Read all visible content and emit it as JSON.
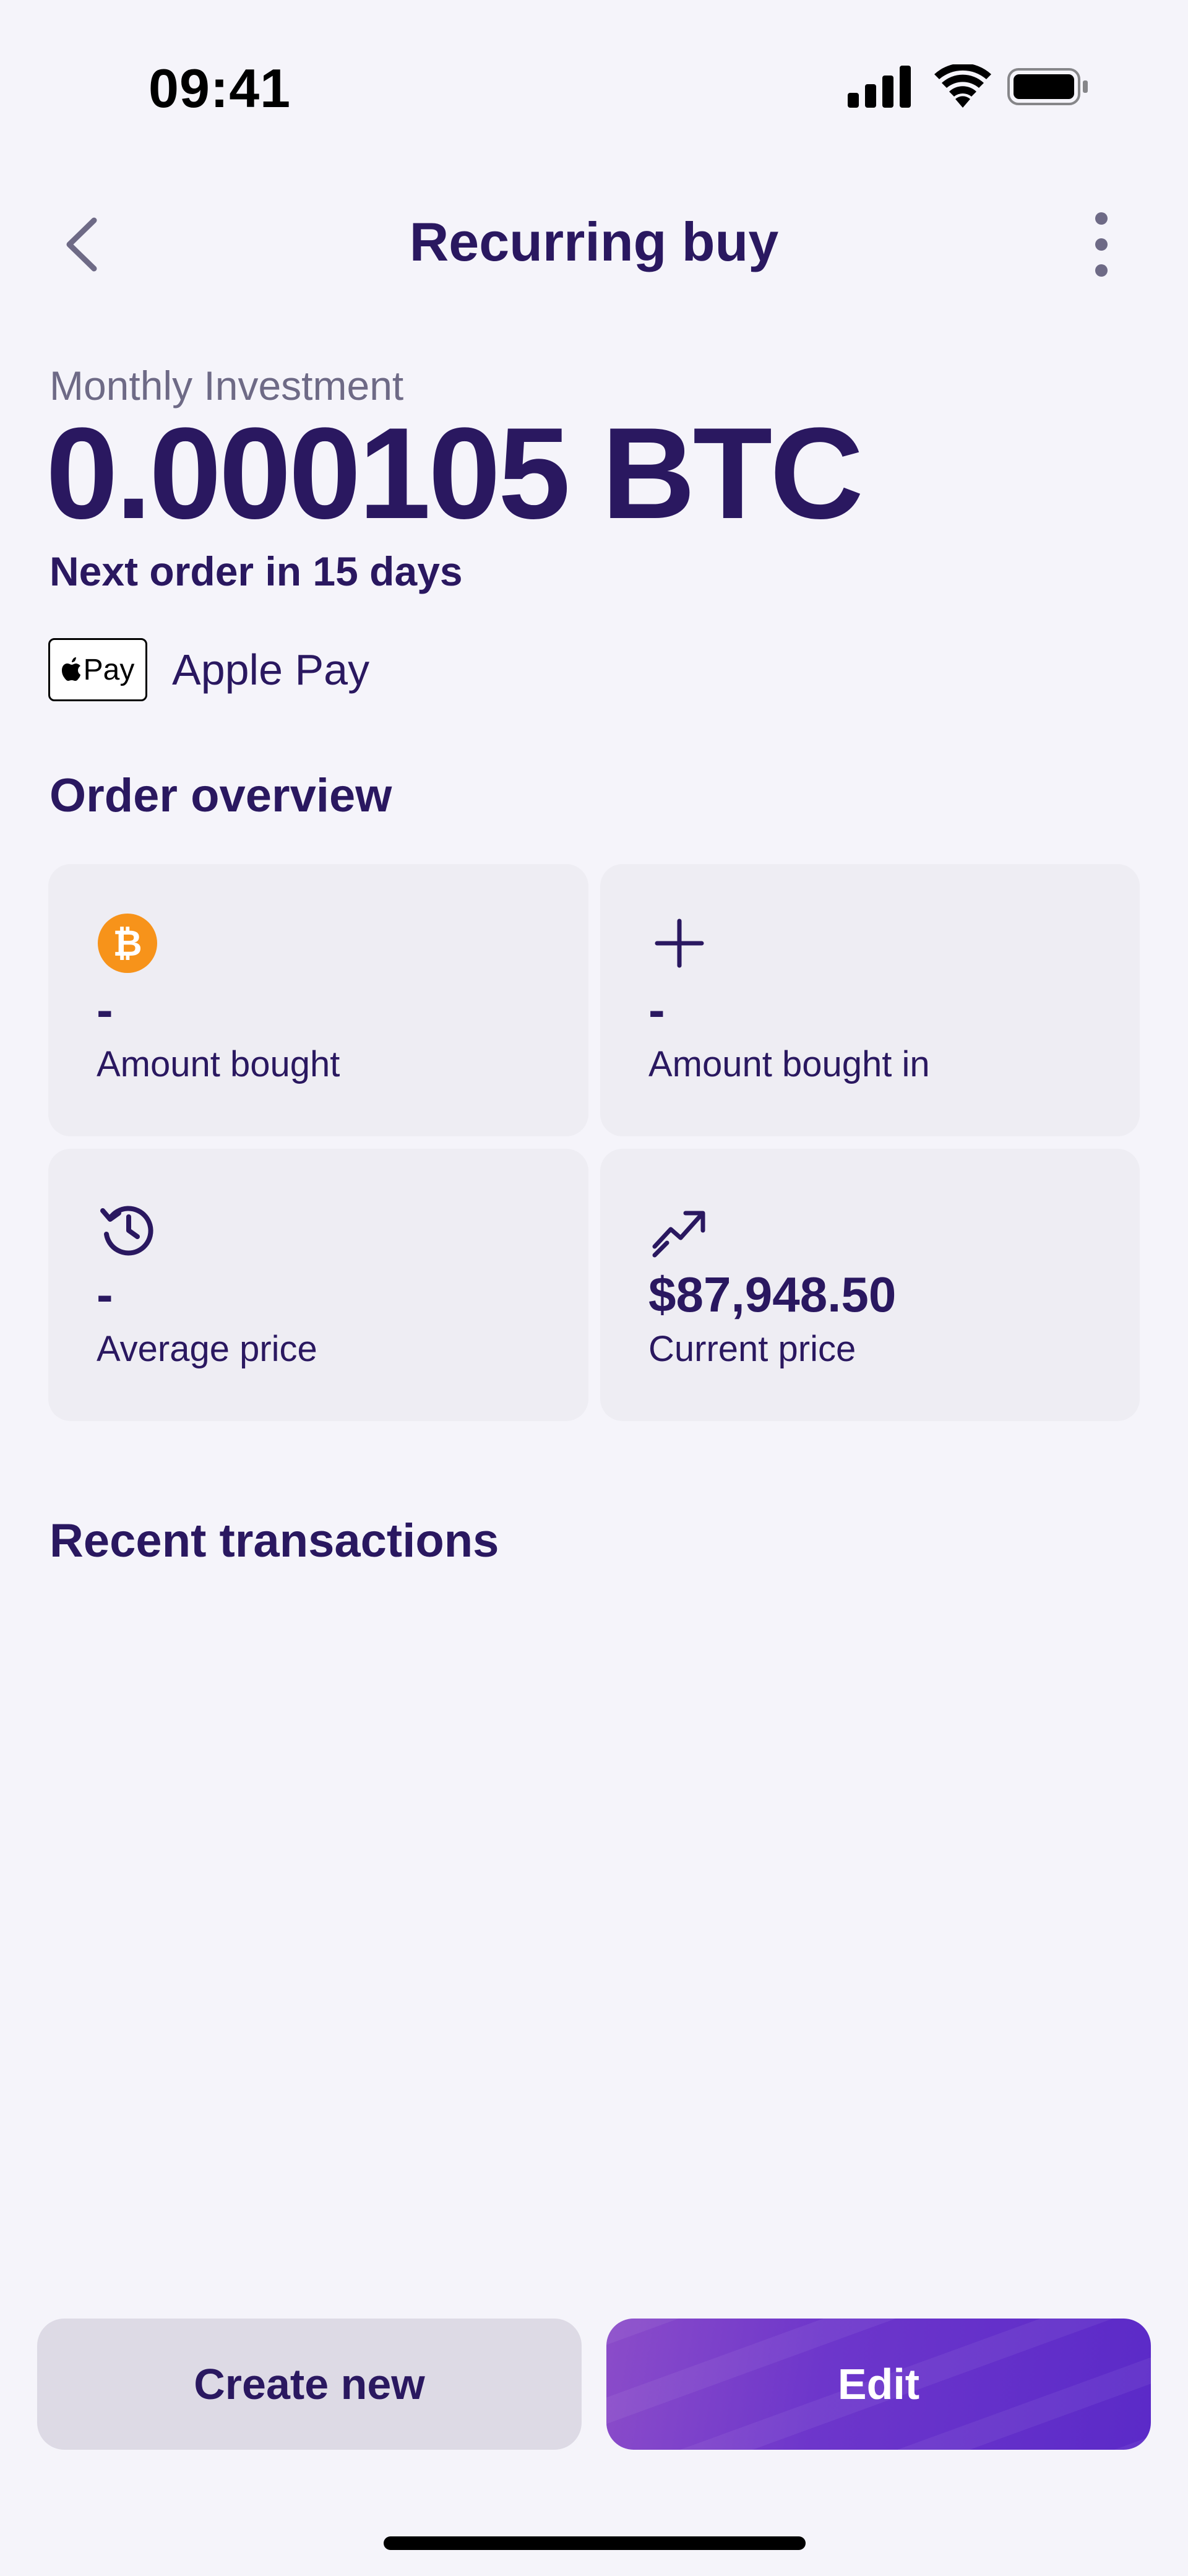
{
  "status_bar": {
    "time": "09:41"
  },
  "nav": {
    "title": "Recurring buy"
  },
  "investment": {
    "label": "Monthly Investment",
    "amount": "0.000105 BTC",
    "next_order": "Next order in 15 days",
    "payment_method": {
      "badge_text": "Pay",
      "label": "Apple Pay"
    }
  },
  "order_overview": {
    "title": "Order overview",
    "cards": [
      {
        "icon": "bitcoin-icon",
        "value": "-",
        "label": "Amount bought"
      },
      {
        "icon": "plus-icon",
        "value": "-",
        "label": "Amount bought in"
      },
      {
        "icon": "history-icon",
        "value": "-",
        "label": "Average price"
      },
      {
        "icon": "trending-up-icon",
        "value": "$87,948.50",
        "label": "Current price"
      }
    ]
  },
  "recent_transactions": {
    "title": "Recent transactions"
  },
  "actions": {
    "create_label": "Create new",
    "edit_label": "Edit"
  },
  "colors": {
    "primary_text": "#2a1860",
    "bitcoin": "#f7931a",
    "edit_button": "#5b2ac8"
  }
}
